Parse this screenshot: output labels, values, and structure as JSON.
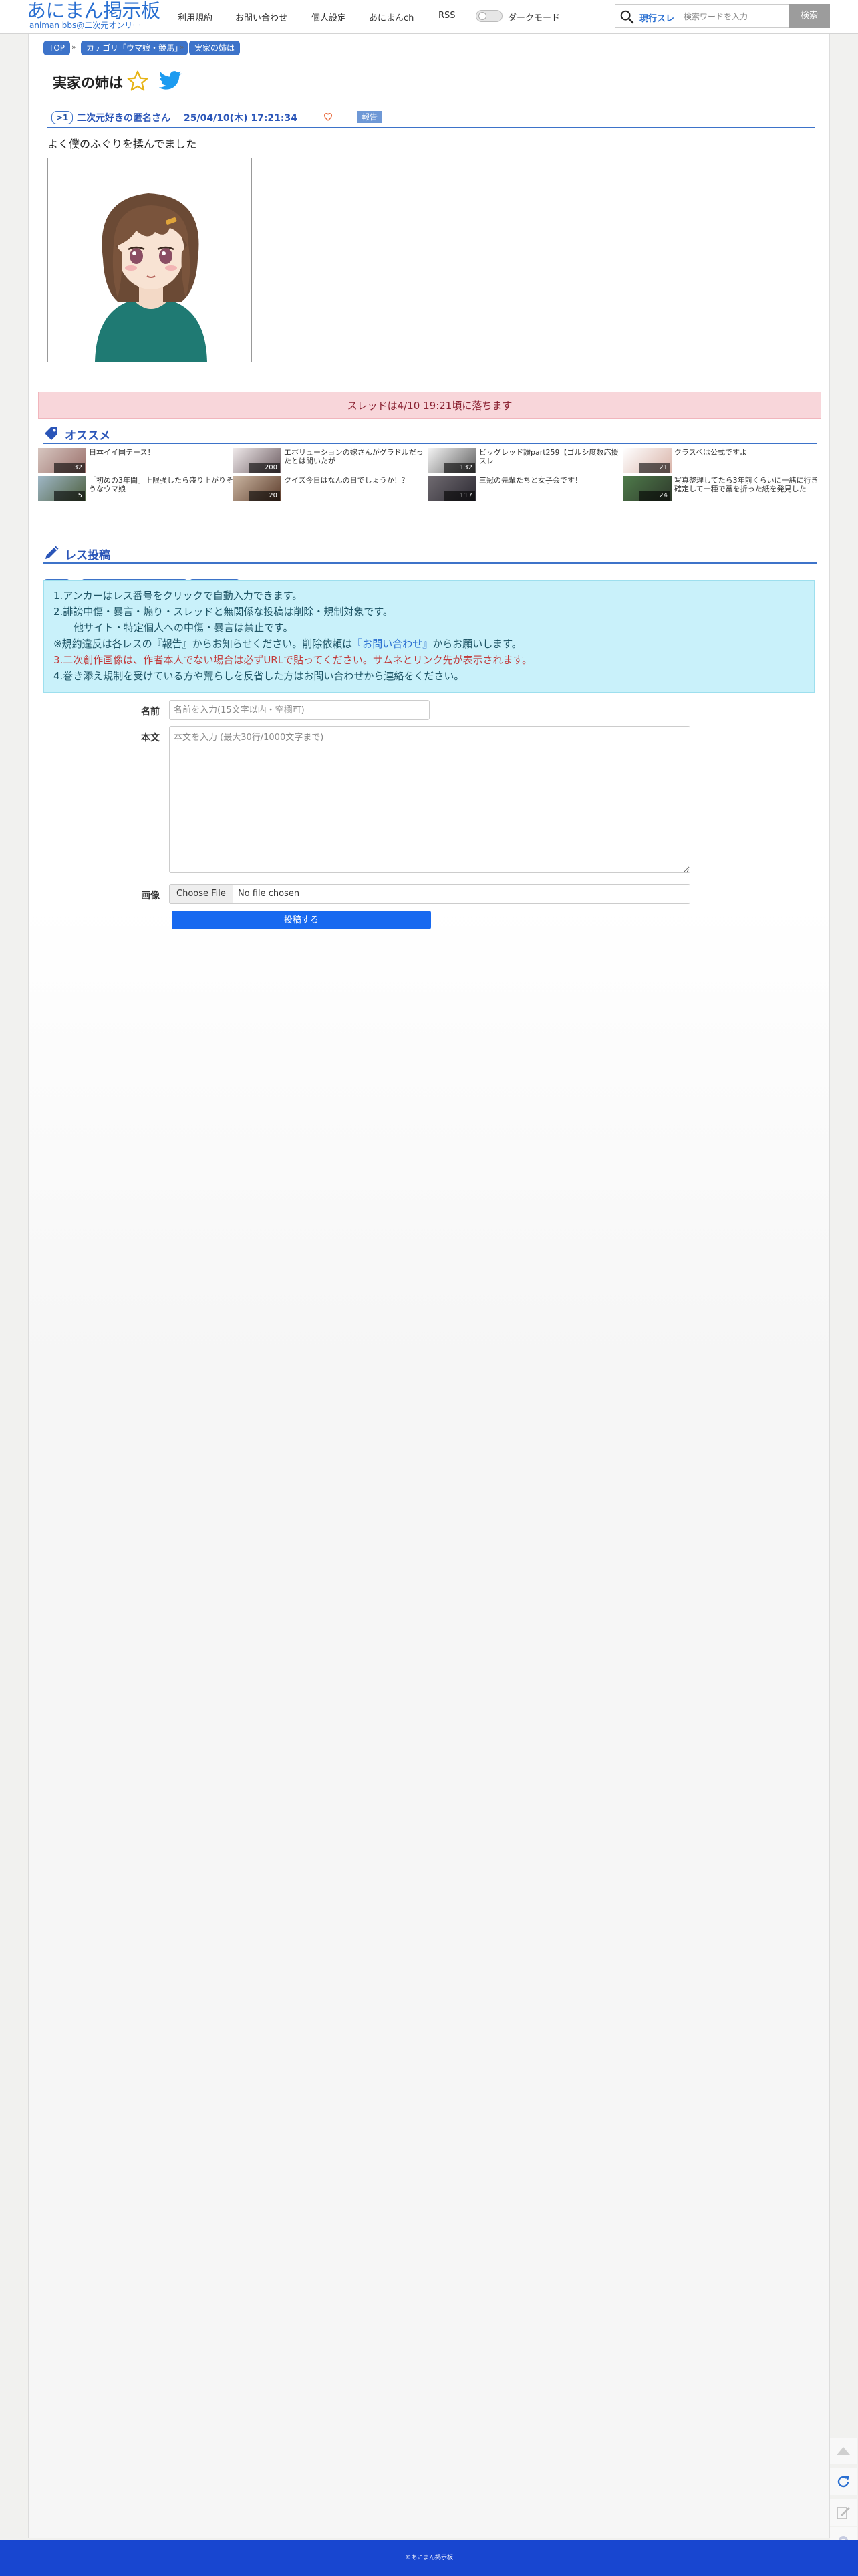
{
  "site": {
    "title": "あにまん掲示板",
    "subtitle": "animan bbs@二次元オンリー"
  },
  "nav": [
    {
      "label": "利用規約"
    },
    {
      "label": "お問い合わせ"
    },
    {
      "label": "個人設定"
    },
    {
      "label": "あにまんch"
    },
    {
      "label": "RSS"
    }
  ],
  "dark_mode": {
    "label": "ダークモード",
    "on": false
  },
  "search": {
    "scope": "現行スレ",
    "placeholder": "検索ワードを入力",
    "button": "検索"
  },
  "breadcrumbs": [
    "TOP",
    "カテゴリ「ウマ娘・競馬」",
    "実家の姉は"
  ],
  "thread": {
    "title": "実家の姉は"
  },
  "post": {
    "number": ">1",
    "author": "二次元好きの匿名さん",
    "date": "25/04/10(木) 17:21:34",
    "report": "報告",
    "body": "よく僕のふぐりを揉んでました"
  },
  "fall_notice": "スレッドは4/10 19:21頃に落ちます",
  "recommend": {
    "heading": "オススメ",
    "items": [
      {
        "title": "日本イイ国テース！",
        "count": "32"
      },
      {
        "title": "エボリューションの嫁さんがグラドルだったとは聞いたが",
        "count": "200"
      },
      {
        "title": "ビッグレッド讃part259【ゴルシ度数応援スレ",
        "count": "132"
      },
      {
        "title": "クラスペは公式ですよ",
        "count": "21"
      },
      {
        "title": "「初めの3年間」上限強したら盛り上がりそうなウマ娘",
        "count": "5"
      },
      {
        "title": "クイズ今日はなんの日でしょうか！？",
        "count": "20"
      },
      {
        "title": "三冠の先輩たちと女子会です！",
        "count": "117"
      },
      {
        "title": "写真整理してたら3年前くらいに一緒に行き確定して一種で藁を折った紙を発見した",
        "count": "24"
      }
    ]
  },
  "reply": {
    "heading": "レス投稿"
  },
  "rules": [
    "1.アンカーはレス番号をクリックで自動入力できます。",
    "2.誹謗中傷・暴言・煽り・スレッドと無関係な投稿は削除・規制対象です。",
    "他サイト・特定個人への中傷・暴言は禁止です。",
    "※規約違反は各レスの『報告』からお知らせください。削除依頼は",
    "『お問い合わせ』",
    "からお願いします。",
    "3.二次創作画像は、作者本人でない場合は必ずURLで貼ってください。サムネとリンク先が表示されます。",
    "4.巻き添え規制を受けている方や荒らしを反省した方はお問い合わせから連絡をください。"
  ],
  "form": {
    "name_label": "名前",
    "name_placeholder": "名前を入力(15文字以内・空欄可)",
    "body_label": "本文",
    "body_placeholder": "本文を入力 (最大30行/1000文字まで)",
    "image_label": "画像",
    "file_button": "Choose File",
    "file_status": "No file chosen",
    "submit": "投稿する"
  },
  "footer": "©あにまん掲示板",
  "colors": {
    "accent": "#3d73c9",
    "link": "#2a55b8",
    "footer": "#1846d0",
    "banner": "#f8d6da",
    "info": "#c9f1fa",
    "submit": "#1769f0"
  }
}
